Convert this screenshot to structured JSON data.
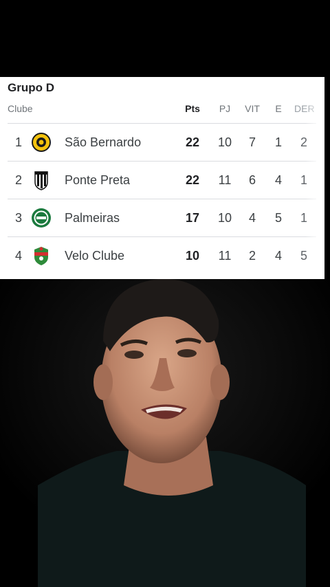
{
  "group": {
    "title": "Grupo D"
  },
  "headers": {
    "clube": "Clube",
    "pts": "Pts",
    "pj": "PJ",
    "vit": "VIT",
    "e": "E",
    "der": "DER"
  },
  "rows": [
    {
      "pos": "1",
      "team": "São Bernardo",
      "pts": "22",
      "pj": "10",
      "vit": "7",
      "e": "1",
      "der": "2",
      "logo": "sao-bernardo-crest"
    },
    {
      "pos": "2",
      "team": "Ponte Preta",
      "pts": "22",
      "pj": "11",
      "vit": "6",
      "e": "4",
      "der": "1",
      "logo": "ponte-preta-crest"
    },
    {
      "pos": "3",
      "team": "Palmeiras",
      "pts": "17",
      "pj": "10",
      "vit": "4",
      "e": "5",
      "der": "1",
      "logo": "palmeiras-crest"
    },
    {
      "pos": "4",
      "team": "Velo Clube",
      "pts": "10",
      "pj": "11",
      "vit": "2",
      "e": "4",
      "der": "5",
      "logo": "velo-clube-crest"
    }
  ],
  "colors": {
    "card_bg": "#ffffff",
    "page_bg": "#000000",
    "text_primary": "#202124",
    "text_secondary": "#70757a",
    "divider": "#dadce0"
  }
}
